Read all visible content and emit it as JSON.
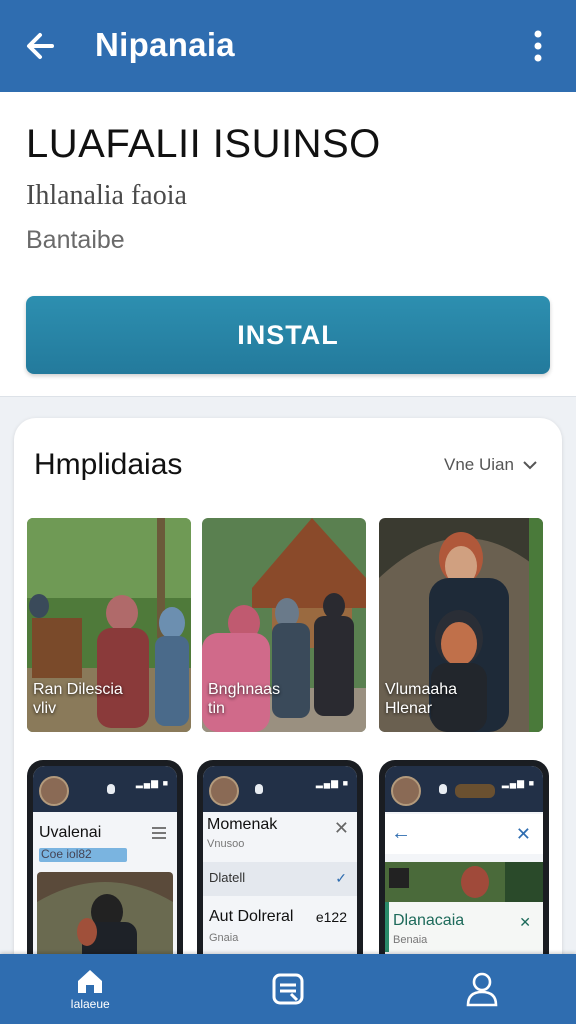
{
  "app_bar": {
    "title": "Nipanaia",
    "back_icon": "arrow-left-icon",
    "more_icon": "more-vertical-icon"
  },
  "app_info": {
    "name": "LUAFALII ISUINSO",
    "subtitle": "Ihlanalia faoia",
    "category": "Bantaibe",
    "install_label": "INSTAL"
  },
  "highlights": {
    "title": "Hmplidaias",
    "see_more": "Vne Uian",
    "photos": [
      {
        "caption_line1": "Ran Dilescia",
        "caption_line2": "vliv"
      },
      {
        "caption_line1": "Bnghnaas",
        "caption_line2": "tin"
      },
      {
        "caption_line1": "Vlumaaha",
        "caption_line2": "Hlenar"
      }
    ],
    "screens": [
      {
        "header": "Uvalenai",
        "sub": "Coe iol82"
      },
      {
        "header": "Momenak",
        "sub": "Vnusoo",
        "row2": "Dlatell",
        "row3": "Aut Dolreral",
        "row3_value": "e122",
        "row3_sub": "Gnaia"
      },
      {
        "header": "Dlanacaia",
        "sub": "Benaia"
      }
    ]
  },
  "bottom_nav": {
    "items": [
      {
        "label": "Ialaeue",
        "icon": "home-icon"
      },
      {
        "label": "",
        "icon": "library-icon"
      },
      {
        "label": "",
        "icon": "profile-icon"
      }
    ]
  },
  "colors": {
    "primary": "#2f6db0",
    "install": "#2d8fb0",
    "background": "#eef1f5"
  }
}
